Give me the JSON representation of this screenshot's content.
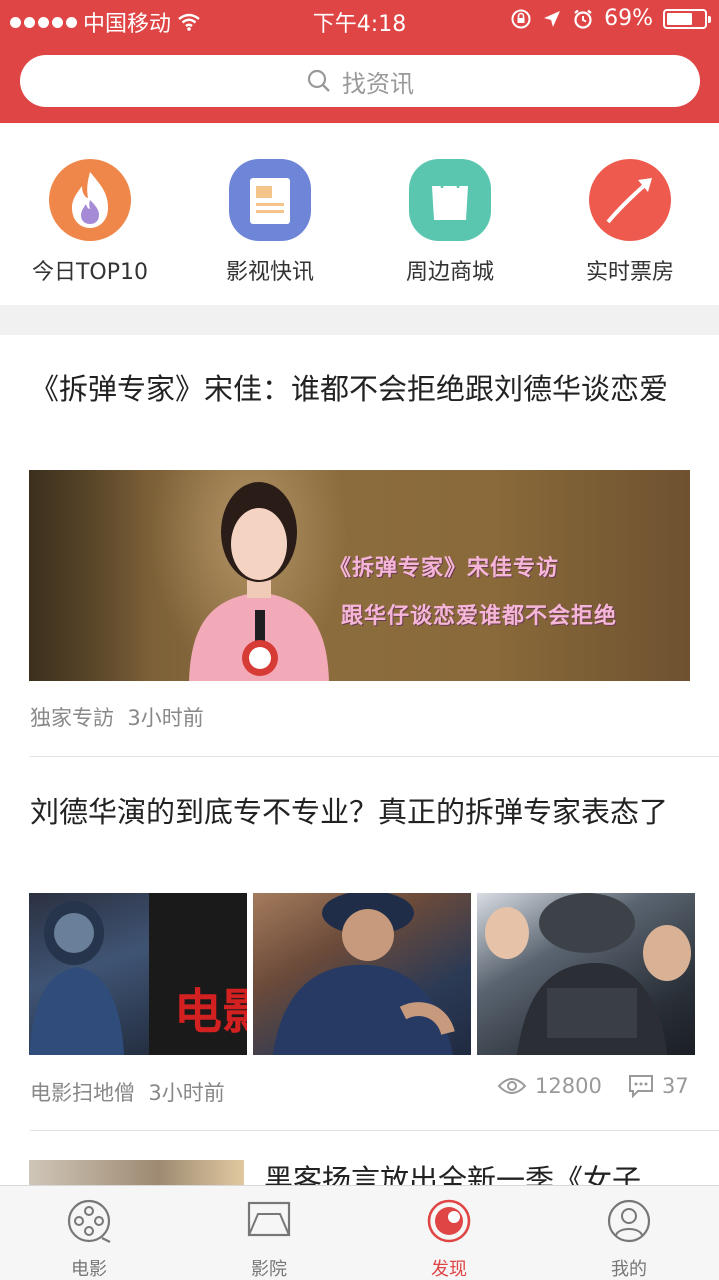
{
  "status_bar": {
    "carrier": "中国移动",
    "time": "下午4:18",
    "battery": "69%",
    "battery_level": 0.69
  },
  "search": {
    "placeholder": "找资讯"
  },
  "quick_entries": [
    {
      "label": "今日TOP10",
      "icon": "flame-icon",
      "color": "#f0874a"
    },
    {
      "label": "影视快讯",
      "icon": "news-icon",
      "color": "#6f86d8"
    },
    {
      "label": "周边商城",
      "icon": "shopping-bag-icon",
      "color": "#5ac6b0"
    },
    {
      "label": "实时票房",
      "icon": "trend-up-icon",
      "color": "#ef5a4e"
    }
  ],
  "articles": [
    {
      "title": "《拆弹专家》宋佳：谁都不会拒绝跟刘德华谈恋爱",
      "source": "独家专訪",
      "time": "3小时前",
      "image_caption_1": "《拆弹专家》宋佳专访",
      "image_caption_2": "跟华仔谈恋爱谁都不会拒绝"
    },
    {
      "title": "刘德华演的到底专不专业？真正的拆弹专家表态了",
      "source": "电影扫地僧",
      "time": "3小时前",
      "views": "12800",
      "comments": "37"
    },
    {
      "title": "黑客扬言放出全新一季《女子"
    }
  ],
  "tabbar": [
    {
      "label": "电影",
      "icon": "film-reel-icon",
      "active": false
    },
    {
      "label": "影院",
      "icon": "cinema-screen-icon",
      "active": false
    },
    {
      "label": "发现",
      "icon": "discover-icon",
      "active": true
    },
    {
      "label": "我的",
      "icon": "profile-icon",
      "active": false
    }
  ],
  "colors": {
    "brand": "#e04545",
    "text": "#222222",
    "meta": "#888888"
  }
}
